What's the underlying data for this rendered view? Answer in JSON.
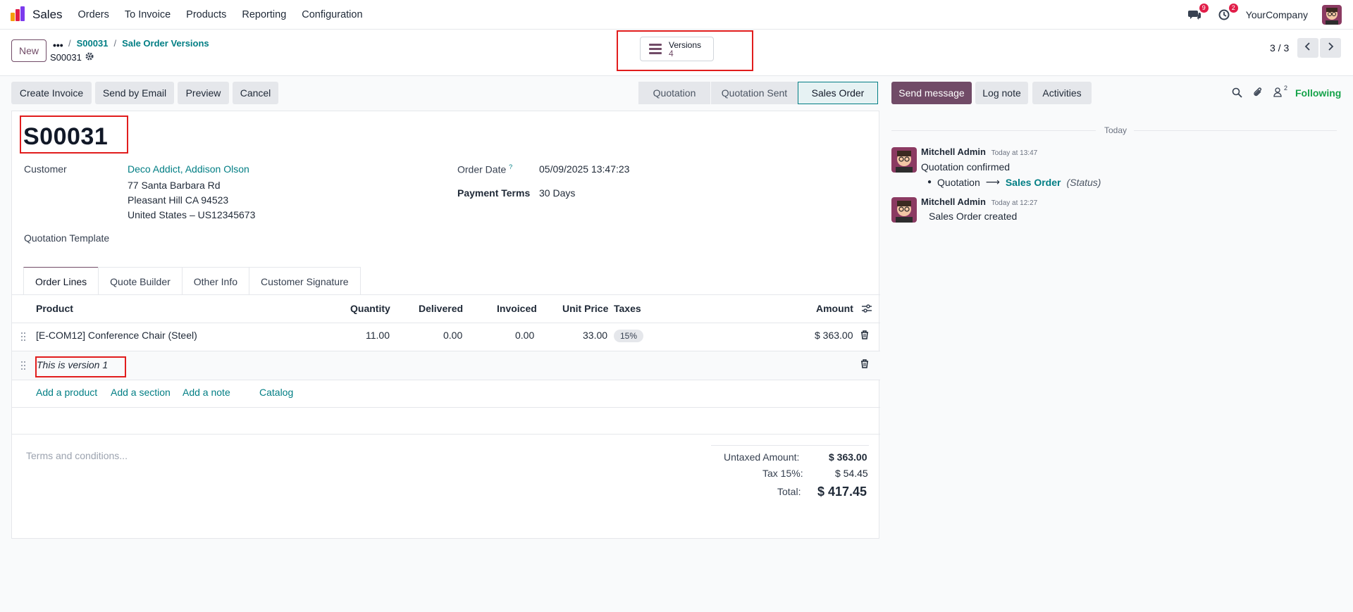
{
  "navbar": {
    "app_name": "Sales",
    "menu": [
      "Orders",
      "To Invoice",
      "Products",
      "Reporting",
      "Configuration"
    ],
    "messages_badge": "9",
    "activities_badge": "2",
    "company": "YourCompany"
  },
  "control_panel": {
    "new_label": "New",
    "breadcrumb_dots": "•••",
    "breadcrumbs": [
      "S00031",
      "Sale Order Versions"
    ],
    "record_name": "S00031",
    "versions_label": "Versions",
    "versions_count": "4",
    "pager": "3 / 3"
  },
  "actions": [
    "Create Invoice",
    "Send by Email",
    "Preview",
    "Cancel"
  ],
  "status_stages": [
    "Quotation",
    "Quotation Sent",
    "Sales Order"
  ],
  "active_stage": "Sales Order",
  "form": {
    "title": "S00031",
    "customer_label": "Customer",
    "customer_name": "Deco Addict, Addison Olson",
    "address_lines": [
      "77 Santa Barbara Rd",
      "Pleasant Hill CA 94523",
      "United States – US12345673"
    ],
    "order_date_label": "Order Date",
    "order_date_help": "?",
    "order_date": "05/09/2025 13:47:23",
    "payment_terms_label": "Payment Terms",
    "payment_terms": "30 Days",
    "quotation_template_label": "Quotation Template",
    "tabs": [
      "Order Lines",
      "Quote Builder",
      "Other Info",
      "Customer Signature"
    ],
    "columns": {
      "product": "Product",
      "quantity": "Quantity",
      "delivered": "Delivered",
      "invoiced": "Invoiced",
      "unit_price": "Unit Price",
      "taxes": "Taxes",
      "amount": "Amount"
    },
    "line": {
      "product": "[E-COM12] Conference Chair (Steel)",
      "quantity": "11.00",
      "delivered": "0.00",
      "invoiced": "0.00",
      "unit_price": "33.00",
      "tax": "15%",
      "amount": "$ 363.00"
    },
    "note_line": "This is version 1",
    "add_links": [
      "Add a product",
      "Add a section",
      "Add a note",
      "Catalog"
    ],
    "terms_placeholder": "Terms and conditions...",
    "totals": {
      "untaxed_label": "Untaxed Amount:",
      "untaxed": "$ 363.00",
      "tax_label": "Tax 15%:",
      "tax": "$ 54.45",
      "total_label": "Total:",
      "total": "$ 417.45"
    }
  },
  "chatter": {
    "send_message": "Send message",
    "log_note": "Log note",
    "activities": "Activities",
    "followers_count": "2",
    "following": "Following",
    "date_separator": "Today",
    "messages": [
      {
        "author": "Mitchell Admin",
        "time": "Today at 13:47",
        "body": "Quotation confirmed",
        "change_from": "Quotation",
        "change_to": "Sales Order",
        "change_field": "(Status)"
      },
      {
        "author": "Mitchell Admin",
        "time": "Today at 12:27",
        "body": "Sales Order created"
      }
    ]
  },
  "colors": {
    "brand": "#714b67",
    "link": "#017e84",
    "highlight_frame": "#e11d1d"
  }
}
